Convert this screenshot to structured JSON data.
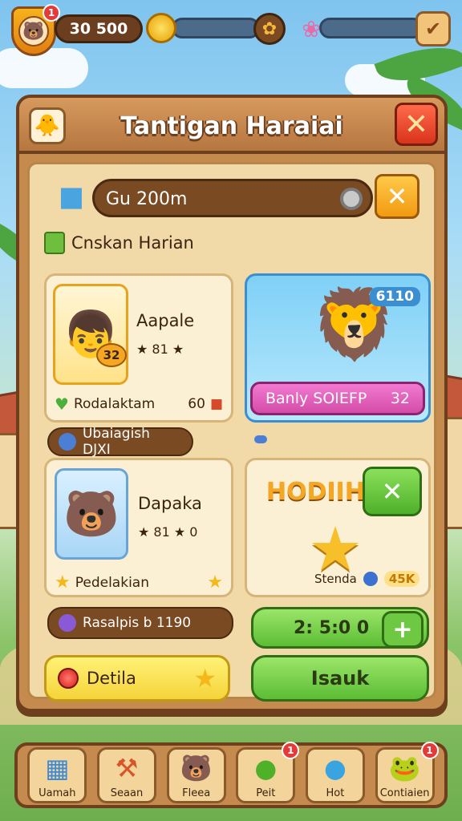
{
  "topbar": {
    "coins": "30 500",
    "notif_count": "1",
    "shield_icon": "bear-face-icon",
    "coin_icon": "gold-coin-icon",
    "gem_icon": "paw-icon",
    "flower_icon": "tulip-icon",
    "settings_icon": "check-badge-icon"
  },
  "panel": {
    "title": "Tantigan Haraiai",
    "search_value": "Gu 200m",
    "section_label": "Cnskan Harian"
  },
  "cards": {
    "card1": {
      "name": "Aapale",
      "stars": "★ 81 ★",
      "badge": "32",
      "footer_label": "Rodalaktam",
      "footer_value": "60"
    },
    "card2": {
      "number": "6110",
      "bar_label": "Banly SOIEFP",
      "bar_value": "32"
    },
    "pill1": "Ubaiagish DJXI",
    "card3": {
      "name": "Dapaka",
      "stars": "★ 81 ★ 0",
      "footer_label": "Pedelakian"
    },
    "card4": {
      "title": "HODIIH!",
      "footer_label": "Stenda",
      "footer_value": "45K"
    },
    "pill2": "Rasalpis b 1190",
    "timer": "2: 5:0 0",
    "yellow_btn": "Detila",
    "green_btn": "Isauk"
  },
  "nav": [
    {
      "label": "Uamah",
      "icon": "blocks-icon",
      "badge": ""
    },
    {
      "label": "Seaan",
      "icon": "hammer-icon",
      "badge": ""
    },
    {
      "label": "Fleea",
      "icon": "bear-icon",
      "badge": ""
    },
    {
      "label": "Peit",
      "icon": "green-orb-icon",
      "badge": "1"
    },
    {
      "label": "Hot",
      "icon": "blue-bear-icon",
      "badge": ""
    },
    {
      "label": "Contiaien",
      "icon": "frog-icon",
      "badge": "1"
    }
  ]
}
